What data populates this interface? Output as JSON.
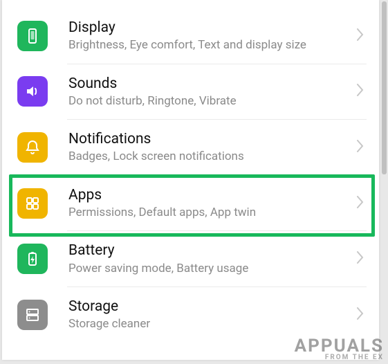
{
  "settings": [
    {
      "id": "display",
      "title": "Display",
      "subtitle": "Brightness, Eye comfort, Text and display size",
      "icon": "display-icon",
      "color": "green"
    },
    {
      "id": "sounds",
      "title": "Sounds",
      "subtitle": "Do not disturb, Ringtone, Vibrate",
      "icon": "sounds-icon",
      "color": "purple"
    },
    {
      "id": "notifications",
      "title": "Notifications",
      "subtitle": "Badges, Lock screen notifications",
      "icon": "notifications-icon",
      "color": "yellow"
    },
    {
      "id": "apps",
      "title": "Apps",
      "subtitle": "Permissions, Default apps, App twin",
      "icon": "apps-icon",
      "color": "yellow",
      "highlighted": true
    },
    {
      "id": "battery",
      "title": "Battery",
      "subtitle": "Power saving mode, Battery usage",
      "icon": "battery-icon",
      "color": "green"
    },
    {
      "id": "storage",
      "title": "Storage",
      "subtitle": "Storage cleaner",
      "icon": "storage-icon",
      "color": "gray"
    }
  ],
  "watermark": {
    "line1": "APPUALS",
    "line2": "FROM THE EX"
  }
}
